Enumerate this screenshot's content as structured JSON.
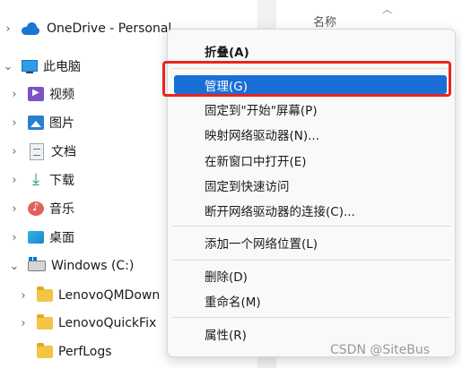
{
  "nav": {
    "items": [
      {
        "label": "OneDrive - Personal",
        "chevron": ">",
        "icon": "onedrive-cloud-icon"
      },
      {
        "label": "此电脑",
        "chevron": "v",
        "icon": "this-pc-icon"
      },
      {
        "label": "视频",
        "chevron": ">",
        "icon": "videos-folder-icon"
      },
      {
        "label": "图片",
        "chevron": ">",
        "icon": "pictures-folder-icon"
      },
      {
        "label": "文档",
        "chevron": ">",
        "icon": "documents-folder-icon"
      },
      {
        "label": "下载",
        "chevron": ">",
        "icon": "downloads-folder-icon"
      },
      {
        "label": "音乐",
        "chevron": ">",
        "icon": "music-folder-icon"
      },
      {
        "label": "桌面",
        "chevron": ">",
        "icon": "desktop-folder-icon"
      },
      {
        "label": "Windows (C:)",
        "chevron": "v",
        "icon": "drive-icon"
      },
      {
        "label": "LenovoQMDown",
        "chevron": ">",
        "icon": "folder-icon"
      },
      {
        "label": "LenovoQuickFix",
        "chevron": ">",
        "icon": "folder-icon"
      },
      {
        "label": "PerfLogs",
        "chevron": "",
        "icon": "folder-icon"
      }
    ]
  },
  "content": {
    "column_header": "名称",
    "sort_indicator": "^"
  },
  "context_menu": {
    "items": [
      {
        "label": "折叠(A)",
        "bold": true
      },
      {
        "label": "管理(G)",
        "selected": true
      },
      {
        "label": "固定到\"开始\"屏幕(P)"
      },
      {
        "label": "映射网络驱动器(N)..."
      },
      {
        "label": "在新窗口中打开(E)"
      },
      {
        "label": "固定到快速访问"
      },
      {
        "label": "断开网络驱动器的连接(C)..."
      },
      {
        "label": "添加一个网络位置(L)"
      },
      {
        "label": "删除(D)"
      },
      {
        "label": "重命名(M)"
      },
      {
        "label": "属性(R)"
      }
    ]
  },
  "watermark": "CSDN @SiteBus",
  "colors": {
    "highlight": "#1a6fd6",
    "annotation_box": "#e8251d"
  }
}
